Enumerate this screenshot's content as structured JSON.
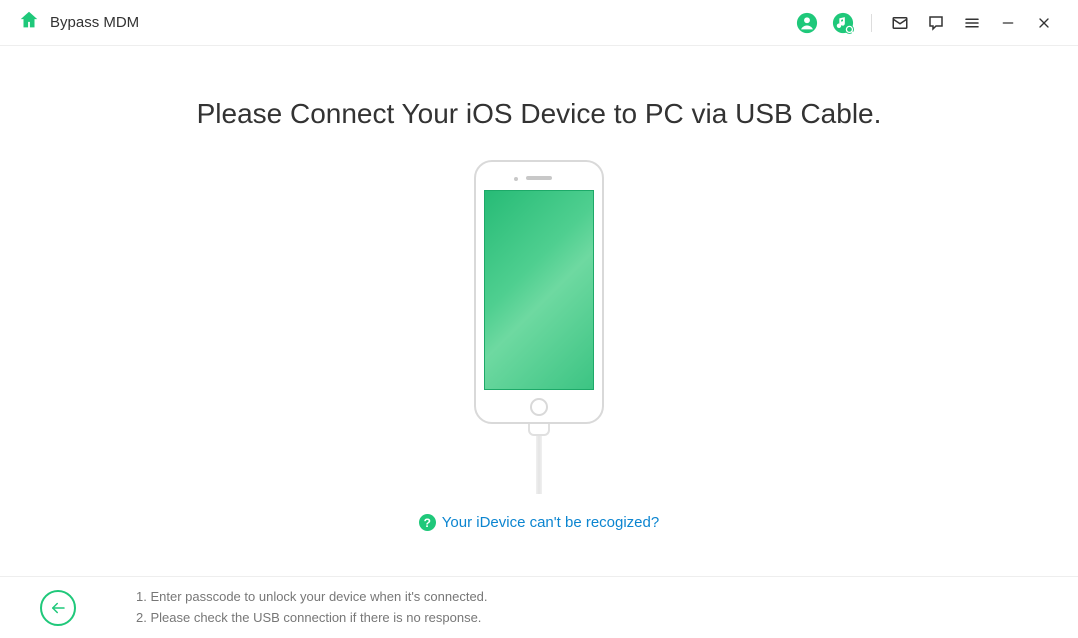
{
  "header": {
    "title": "Bypass MDM"
  },
  "main": {
    "heading": "Please Connect Your iOS Device to PC via USB Cable.",
    "help_link": "Your iDevice can't be recogized?"
  },
  "footer": {
    "tip1": "1. Enter passcode to unlock your device when it's connected.",
    "tip2": "2. Please check the USB connection if there is no response."
  },
  "colors": {
    "accent": "#1fc87a",
    "link": "#0c85d0"
  }
}
